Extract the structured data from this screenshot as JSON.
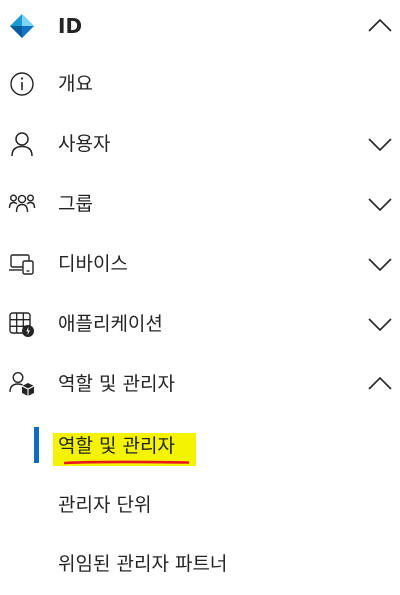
{
  "colors": {
    "text": "#242424",
    "icon": "#242424",
    "accent_bar": "#0f6cbd",
    "highlight": "#f4f400",
    "underline": "#e8181e"
  },
  "nav": {
    "section": {
      "label": "ID",
      "icon": "identity-diamond-icon",
      "expanded": true
    },
    "items": [
      {
        "label": "개요",
        "icon": "info-icon",
        "has_chevron": false
      },
      {
        "label": "사용자",
        "icon": "person-icon",
        "has_chevron": true,
        "expanded": false
      },
      {
        "label": "그룹",
        "icon": "people-team-icon",
        "has_chevron": true,
        "expanded": false
      },
      {
        "label": "디바이스",
        "icon": "devices-icon",
        "has_chevron": true,
        "expanded": false
      },
      {
        "label": "애플리케이션",
        "icon": "app-grid-icon",
        "has_chevron": true,
        "expanded": false
      },
      {
        "label": "역할 및 관리자",
        "icon": "person-roles-icon",
        "has_chevron": true,
        "expanded": true
      }
    ],
    "sub_items": [
      {
        "label": "역할 및 관리자",
        "active": true
      },
      {
        "label": "관리자 단위",
        "active": false
      },
      {
        "label": "위임된 관리자 파트너",
        "active": false
      }
    ]
  }
}
